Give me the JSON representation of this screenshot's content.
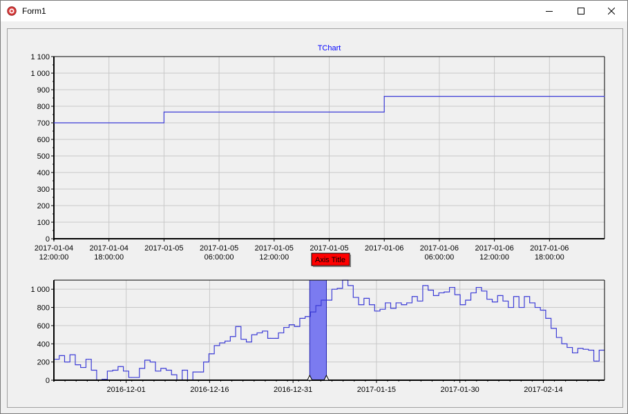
{
  "window": {
    "title": "Form1"
  },
  "icons": {
    "app": "tchart-app-icon",
    "minimize": "minimize-icon",
    "maximize": "maximize-icon",
    "close": "close-icon"
  },
  "colors": {
    "series": "#3b3bd6",
    "grid": "#c8c8c8",
    "title": "#0000ff",
    "range_fill": "#7b7bf0",
    "range_stroke": "#2020b0",
    "tooltip": "#ff0000"
  },
  "tooltip": {
    "text": "Axis Title"
  },
  "chart_data": [
    {
      "type": "line",
      "step": true,
      "title": "TChart",
      "xlabel": "",
      "ylabel": "",
      "ylim": [
        0,
        1100
      ],
      "yticks": [
        0,
        100,
        200,
        300,
        400,
        500,
        600,
        700,
        800,
        900,
        1000,
        1100
      ],
      "ytick_labels": [
        "0",
        "100",
        "200",
        "300",
        "400",
        "500",
        "600",
        "700",
        "800",
        "900",
        "1 000",
        "1 100"
      ],
      "xlim_hours": [
        84,
        144
      ],
      "x_ticks": [
        {
          "h": 84,
          "date": "2017-01-04",
          "time": "12:00:00"
        },
        {
          "h": 90,
          "date": "2017-01-04",
          "time": "18:00:00"
        },
        {
          "h": 96,
          "date": "2017-01-05",
          "time": ""
        },
        {
          "h": 102,
          "date": "2017-01-05",
          "time": "06:00:00"
        },
        {
          "h": 108,
          "date": "2017-01-05",
          "time": "12:00:00"
        },
        {
          "h": 114,
          "date": "2017-01-05",
          "time": "18:00:00"
        },
        {
          "h": 120,
          "date": "2017-01-06",
          "time": ""
        },
        {
          "h": 126,
          "date": "2017-01-06",
          "time": "06:00:00"
        },
        {
          "h": 132,
          "date": "2017-01-06",
          "time": "12:00:00"
        },
        {
          "h": 138,
          "date": "2017-01-06",
          "time": "18:00:00"
        }
      ],
      "points": [
        {
          "x": "2017-01-04 12:00",
          "y": 700
        },
        {
          "x": "2017-01-05 00:00",
          "y": 765
        },
        {
          "x": "2017-01-06 00:00",
          "y": 860
        },
        {
          "x": "2017-01-07 00:00",
          "y": 860
        }
      ],
      "grid": true
    },
    {
      "type": "line",
      "step": true,
      "title": "",
      "ylim": [
        0,
        1100
      ],
      "yticks": [
        0,
        200,
        400,
        600,
        800,
        1000
      ],
      "ytick_labels": [
        "0",
        "200",
        "400",
        "600",
        "800",
        "1 000"
      ],
      "x_start": "2016-11-18",
      "x_end": "2017-02-25",
      "x_tick_labels": [
        "2016-12-01",
        "2016-12-16",
        "2016-12-31",
        "2017-01-15",
        "2017-01-30",
        "2017-02-14"
      ],
      "values": [
        230,
        270,
        200,
        280,
        170,
        140,
        230,
        110,
        0,
        10,
        100,
        110,
        150,
        100,
        30,
        30,
        130,
        220,
        200,
        100,
        130,
        110,
        60,
        0,
        110,
        0,
        90,
        90,
        200,
        290,
        380,
        410,
        430,
        480,
        590,
        450,
        420,
        500,
        520,
        540,
        460,
        460,
        520,
        580,
        610,
        590,
        680,
        700,
        750,
        820,
        880,
        880,
        1000,
        1010,
        1100,
        1040,
        910,
        830,
        900,
        830,
        760,
        780,
        850,
        790,
        850,
        830,
        850,
        920,
        870,
        1040,
        990,
        930,
        960,
        970,
        1020,
        940,
        830,
        880,
        960,
        1020,
        980,
        890,
        860,
        930,
        870,
        800,
        920,
        800,
        920,
        850,
        800,
        770,
        680,
        570,
        470,
        400,
        360,
        300,
        350,
        340,
        330,
        210,
        330
      ],
      "range_selection": {
        "from": "2017-01-03",
        "to": "2017-01-06"
      },
      "grid": true
    }
  ]
}
